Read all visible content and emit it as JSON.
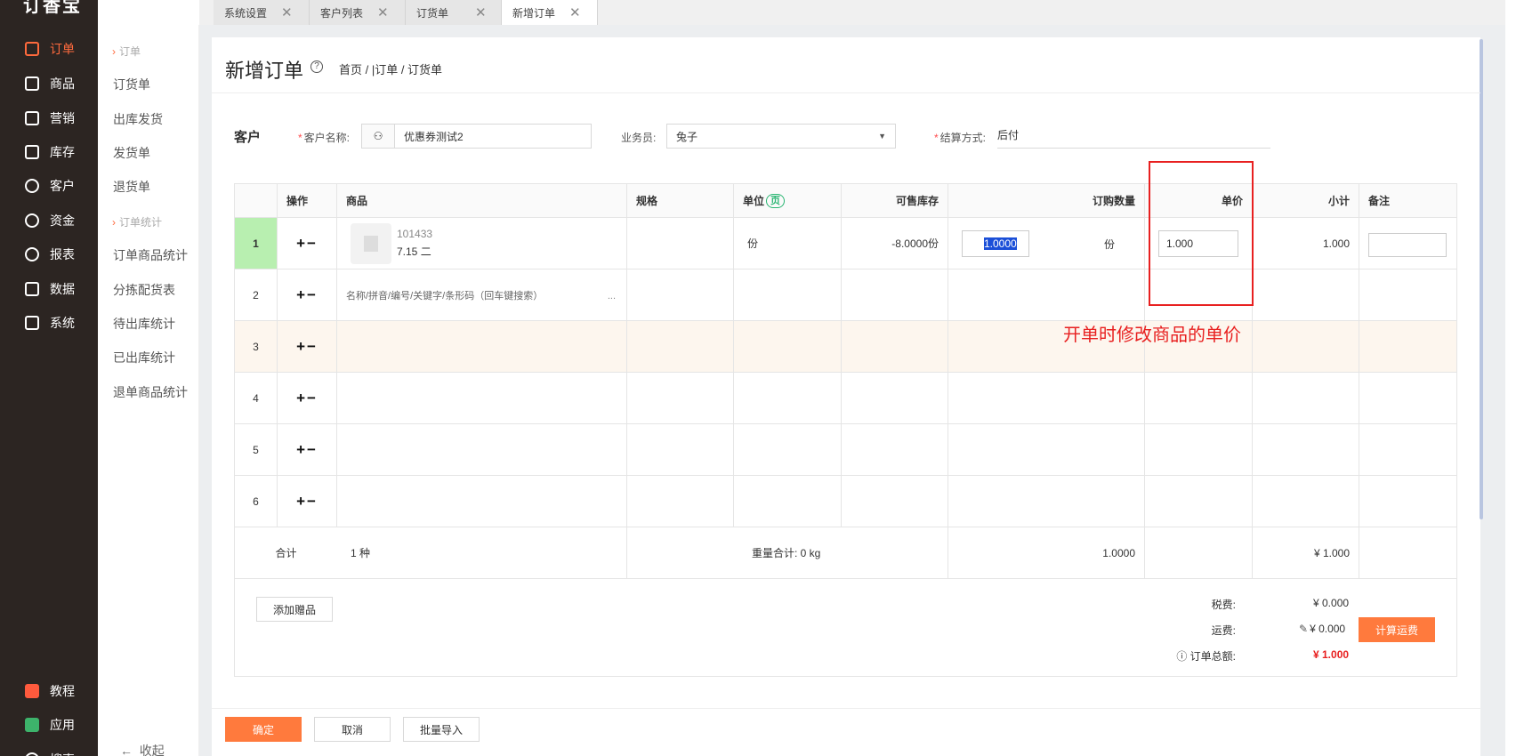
{
  "app": {
    "logo": "订香宝"
  },
  "nav": {
    "items": [
      "订单",
      "商品",
      "营销",
      "库存",
      "客户",
      "资金",
      "报表",
      "数据",
      "系统"
    ],
    "bottom": [
      "教程",
      "应用",
      "搜索"
    ]
  },
  "subnav": {
    "group1": "订单",
    "items1": [
      "订货单",
      "出库发货",
      "发货单",
      "退货单"
    ],
    "group2": "订单统计",
    "items2": [
      "订单商品统计",
      "分拣配货表",
      "待出库统计",
      "已出库统计",
      "退单商品统计"
    ],
    "collapse": "收起"
  },
  "tabs": [
    "系统设置",
    "客户列表",
    "订货单",
    "新增订单"
  ],
  "page": {
    "title": "新增订单",
    "breadcrumb": "首页 / |订单 / 订货单"
  },
  "form": {
    "section": "客户",
    "customer_label": "客户名称:",
    "customer_value": "优惠券测试2",
    "sales_label": "业务员:",
    "sales_value": "兔子",
    "settle_label": "结算方式:",
    "settle_value": "后付"
  },
  "table": {
    "headers": {
      "op": "操作",
      "product": "商品",
      "spec": "规格",
      "unit": "单位",
      "unit_badge": "页",
      "stock": "可售库存",
      "qty": "订购数量",
      "price": "单价",
      "subtotal": "小计",
      "note": "备注"
    },
    "row1": {
      "no": "1",
      "ops": "+−",
      "code": "101433",
      "name": "7.15 二",
      "unit": "份",
      "stock": "-8.0000份",
      "qty": "1.0000",
      "qty_unit": "份",
      "price": "1.000",
      "subtotal": "1.000"
    },
    "row2": {
      "no": "2",
      "ops": "+−",
      "placeholder": "名称/拼音/编号/关键字/条形码（回车键搜索）",
      "more": "..."
    },
    "rows": [
      "3",
      "4",
      "5",
      "6"
    ],
    "ops": "+−",
    "total": {
      "label": "合计",
      "kinds": "1 种",
      "weight": "重量合计: 0 kg",
      "qty": "1.0000",
      "amount": "¥ 1.000"
    }
  },
  "annotation": "开单时修改商品的单价",
  "summary": {
    "tax_label": "税费:",
    "tax": "¥ 0.000",
    "freight_label": "运费:",
    "freight": "¥ 0.000",
    "total_label": "订单总额:",
    "total": "¥ 1.000"
  },
  "buttons": {
    "add_gift": "添加赠品",
    "calc_freight": "计算运费",
    "confirm": "确定",
    "cancel": "取消",
    "batch_import": "批量导入"
  },
  "colors": {
    "accent": "#ff7a3d",
    "annotation": "#e82020",
    "sidebar": "#2c2522"
  }
}
